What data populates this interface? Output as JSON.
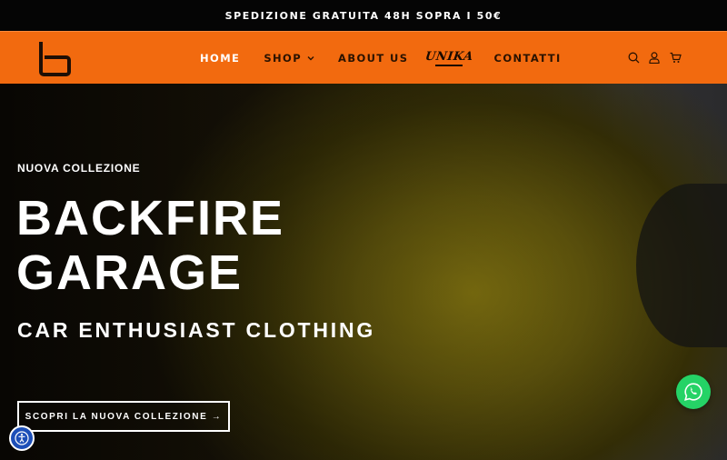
{
  "announcement": {
    "text": "SPEDIZIONE GRATUITA 48H  SOPRA I 50€"
  },
  "header": {
    "logo_icon": "backfire-b-logo",
    "nav": [
      {
        "label": "HOME",
        "active": true
      },
      {
        "label": "SHOP",
        "has_dropdown": true
      },
      {
        "label": "ABOUT US"
      },
      {
        "label": "CONTATTI"
      }
    ],
    "unika_logo_text": "UNIKA",
    "icons": [
      "search-icon",
      "account-icon",
      "cart-icon"
    ]
  },
  "hero": {
    "eyebrow": "NUOVA COLLEZIONE",
    "title_line1": "BACKFIRE",
    "title_line2": "GARAGE",
    "subtitle": "CAR ENTHUSIAST CLOTHING",
    "cta_label": "SCOPRI LA NUOVA COLLEZIONE →"
  },
  "floating": {
    "chat_icon": "whatsapp-icon",
    "accessibility_icon": "accessibility-icon"
  },
  "colors": {
    "nav_bg": "#f26a0f",
    "announce_bg": "#050505",
    "whatsapp": "#25d366",
    "accessibility": "#1d4fb8"
  }
}
